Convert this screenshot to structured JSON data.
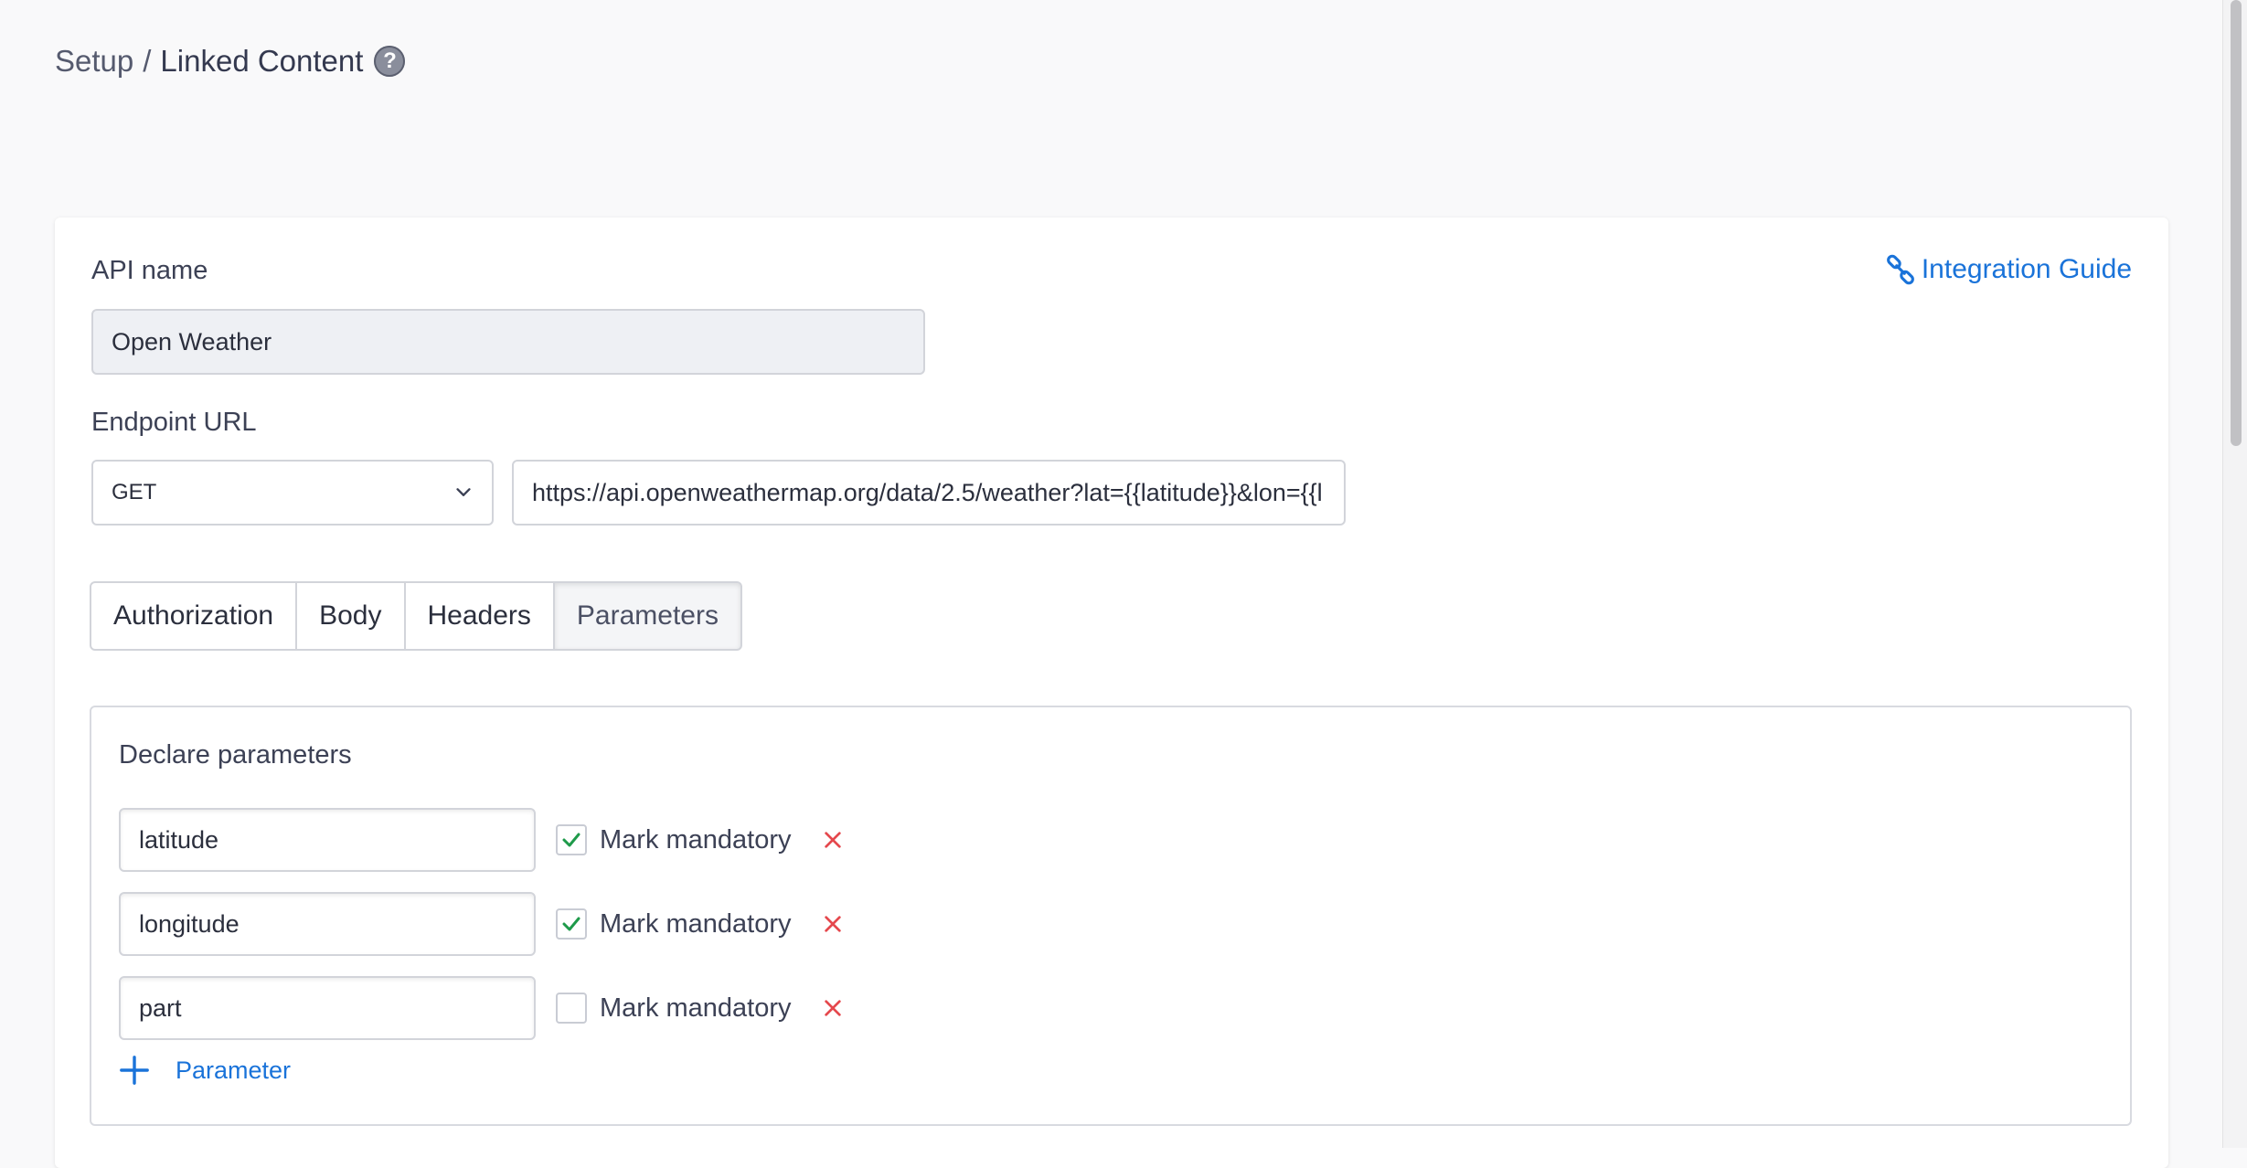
{
  "breadcrumb": {
    "parent": "Setup",
    "separator": "/",
    "current": "Linked Content",
    "help": "?"
  },
  "form": {
    "api_name_label": "API name",
    "api_name_value": "Open Weather",
    "integration_guide": "Integration Guide",
    "endpoint_label": "Endpoint URL",
    "method": "GET",
    "url": "https://api.openweathermap.org/data/2.5/weather?lat={{latitude}}&lon={{l"
  },
  "tabs": [
    {
      "label": "Authorization",
      "active": false
    },
    {
      "label": "Body",
      "active": false
    },
    {
      "label": "Headers",
      "active": false
    },
    {
      "label": "Parameters",
      "active": true
    }
  ],
  "parameters": {
    "title": "Declare parameters",
    "mandatory_label": "Mark mandatory",
    "items": [
      {
        "name": "latitude",
        "mandatory": true
      },
      {
        "name": "longitude",
        "mandatory": true
      },
      {
        "name": "part",
        "mandatory": false
      }
    ],
    "add_label": "Parameter"
  },
  "colors": {
    "link": "#1a73d9",
    "check": "#1e9a4a",
    "remove": "#e5484d"
  }
}
